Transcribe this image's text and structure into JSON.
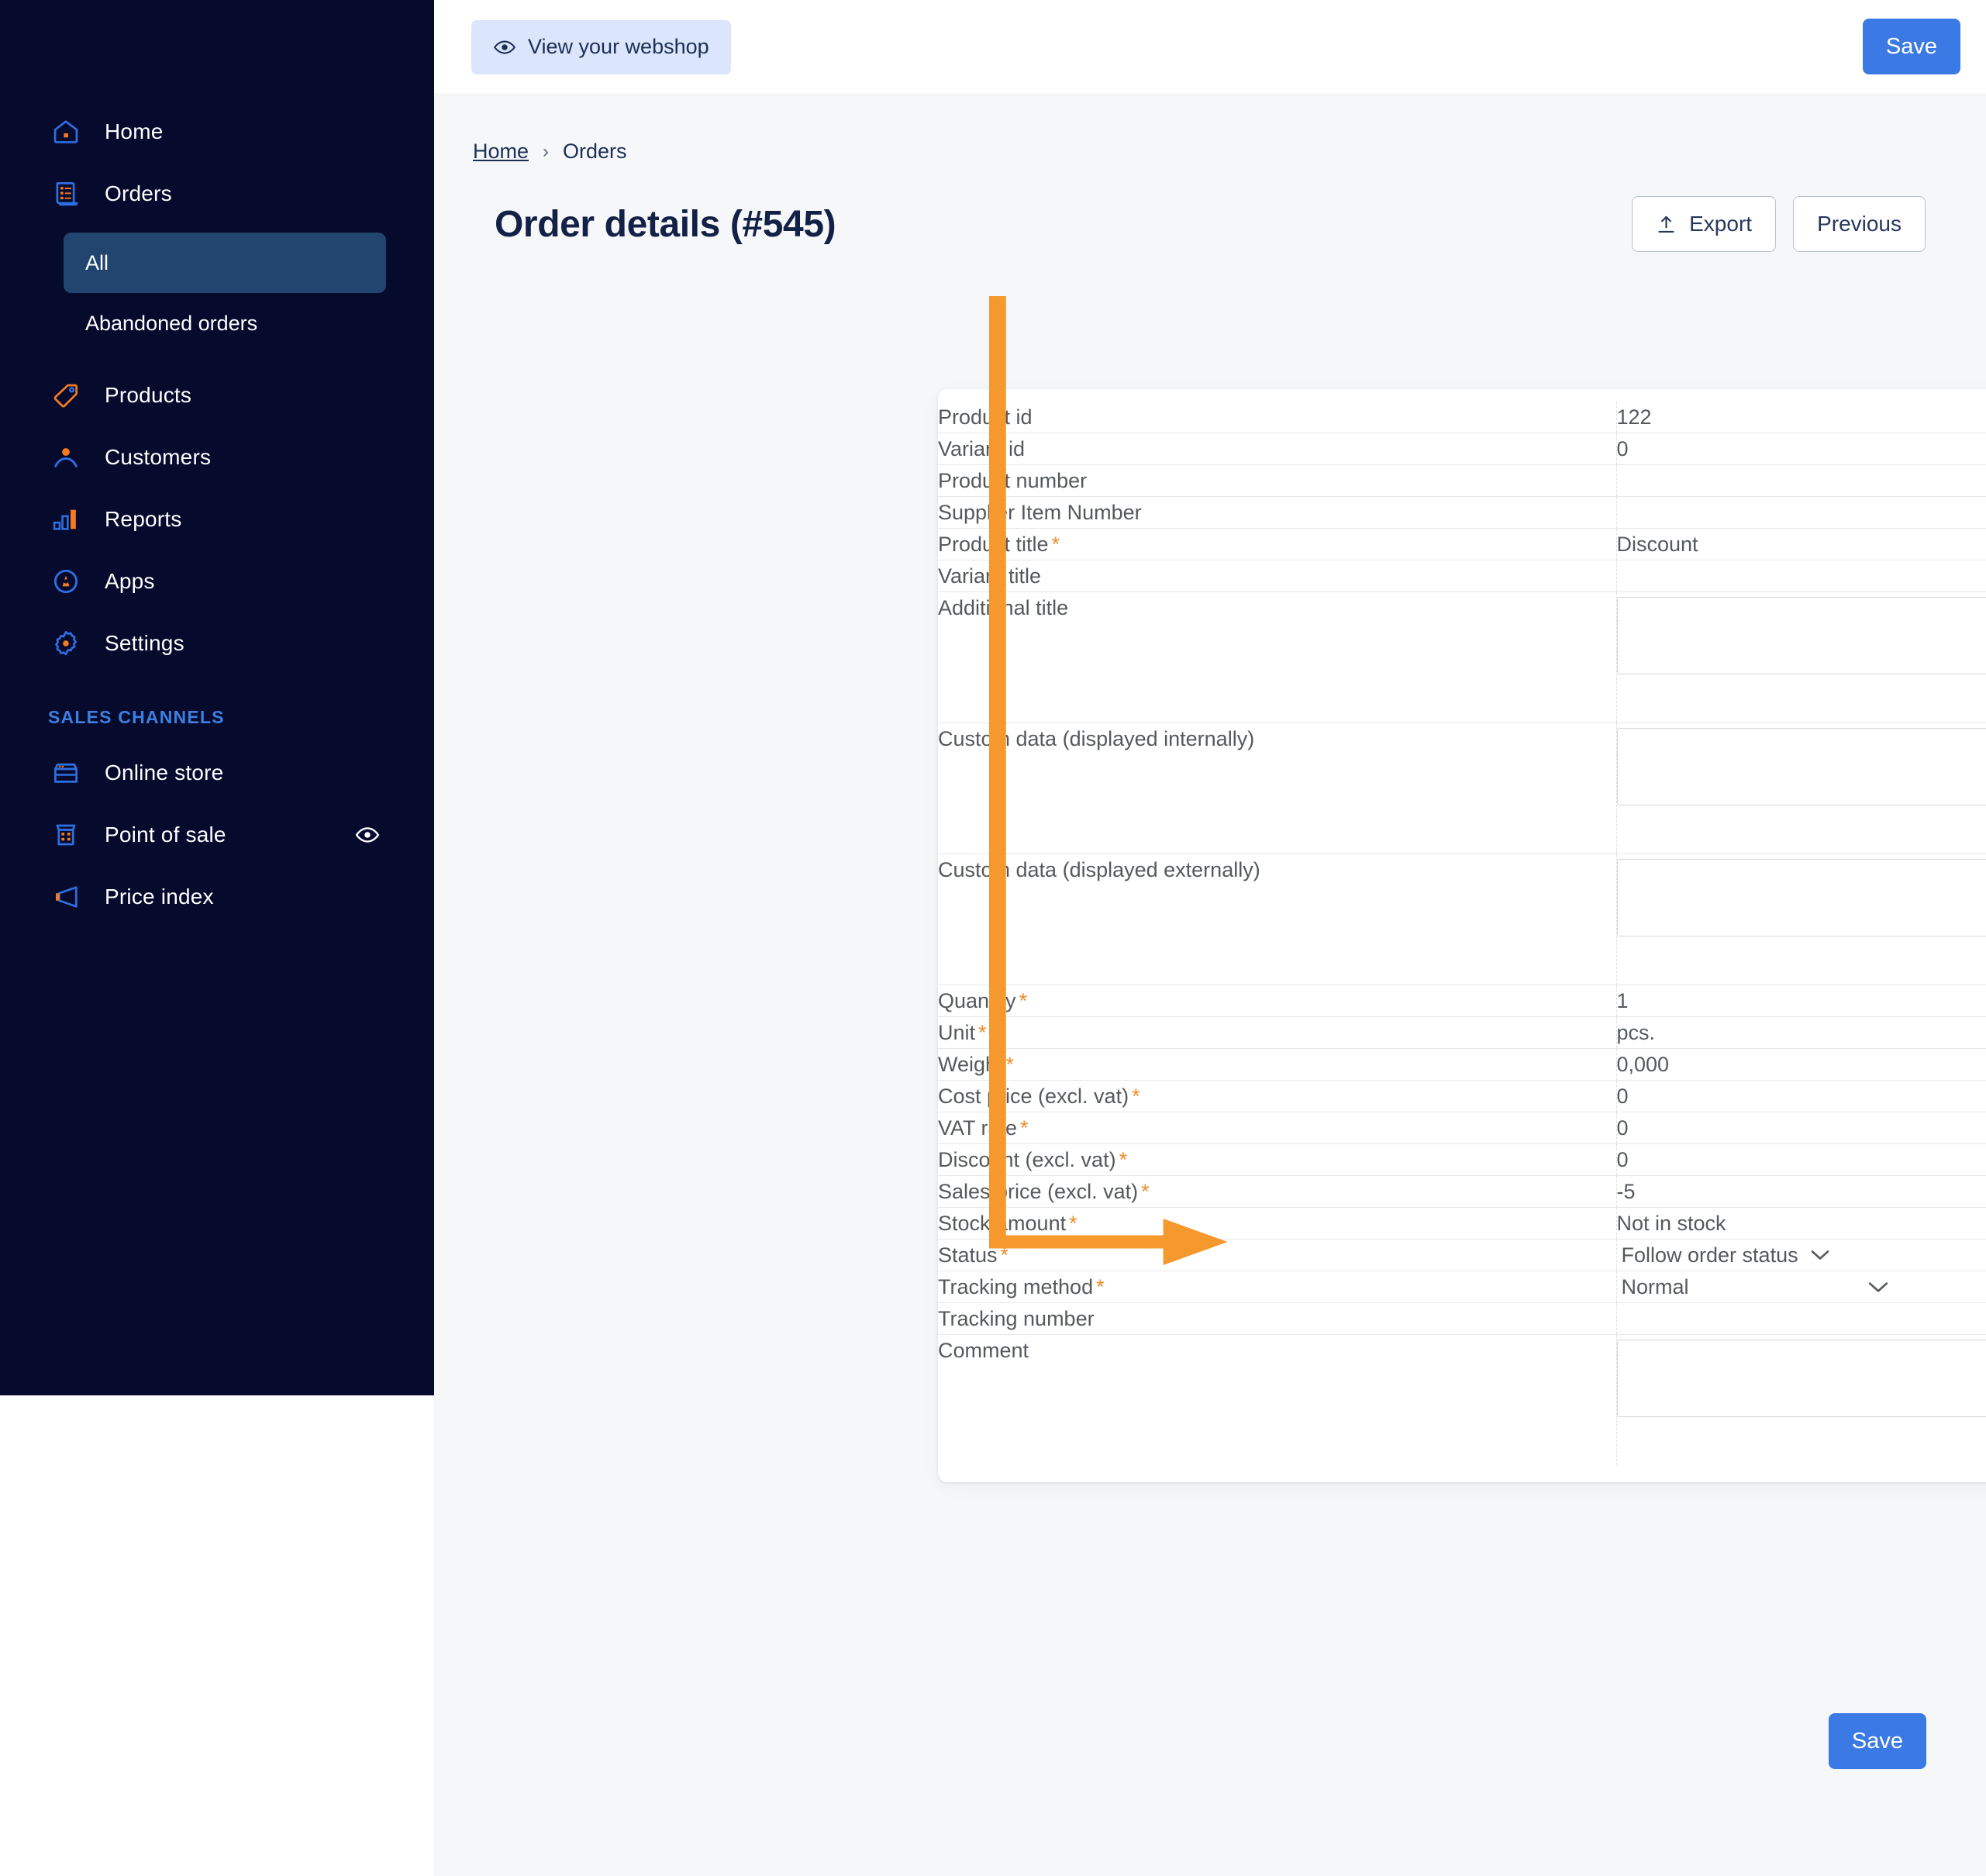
{
  "theme": {
    "sidebar_bg": "#060b2e",
    "sidebar_active_bg": "#21456f",
    "accent_blue": "#3b7ae4",
    "icon_blue": "#2f6fe0",
    "icon_orange": "#f47b20",
    "annotation_orange": "#f5992e",
    "required_orange": "#f08b2c",
    "page_bg": "#f6f7f9"
  },
  "sidebar": {
    "items": [
      {
        "label": "Home",
        "icon": "home-icon"
      },
      {
        "label": "Orders",
        "icon": "orders-icon"
      }
    ],
    "orders_sub": [
      {
        "label": "All",
        "active": true
      },
      {
        "label": "Abandoned orders",
        "active": false
      }
    ],
    "items2": [
      {
        "label": "Products",
        "icon": "tag-icon"
      },
      {
        "label": "Customers",
        "icon": "user-icon"
      },
      {
        "label": "Reports",
        "icon": "bar-chart-icon"
      },
      {
        "label": "Apps",
        "icon": "apps-icon"
      },
      {
        "label": "Settings",
        "icon": "gear-icon"
      }
    ],
    "group_title": "SALES CHANNELS",
    "channels": [
      {
        "label": "Online store",
        "icon": "store-icon",
        "trailing": null
      },
      {
        "label": "Point of sale",
        "icon": "pos-icon",
        "trailing": "eye-icon"
      },
      {
        "label": "Price index",
        "icon": "megaphone-icon",
        "trailing": null
      }
    ]
  },
  "topbar": {
    "view_webshop": "View your webshop",
    "save": "Save"
  },
  "breadcrumb": {
    "home": "Home",
    "separator": "›",
    "current": "Orders"
  },
  "header": {
    "title": "Order details (#545)",
    "export": "Export",
    "previous": "Previous"
  },
  "footer": {
    "save": "Save"
  },
  "table": {
    "rows": [
      {
        "label": "Product id",
        "required": false,
        "value": "122",
        "type": "text"
      },
      {
        "label": "Variant id",
        "required": false,
        "value": "0",
        "type": "text"
      },
      {
        "label": "Product number",
        "required": false,
        "value": "",
        "type": "text"
      },
      {
        "label": "Supplier Item Number",
        "required": false,
        "value": "",
        "type": "text"
      },
      {
        "label": "Product title",
        "required": true,
        "value": "Discount",
        "type": "text"
      },
      {
        "label": "Variant title",
        "required": false,
        "value": "",
        "type": "text"
      },
      {
        "label": "Additional title",
        "required": false,
        "value": "",
        "type": "textarea"
      },
      {
        "label": "Custom data (displayed internally)",
        "required": false,
        "value": "",
        "type": "textarea"
      },
      {
        "label": "Custom data (displayed externally)",
        "required": false,
        "value": "",
        "type": "textarea"
      },
      {
        "label": "Quantity",
        "required": true,
        "value": "1",
        "type": "text"
      },
      {
        "label": "Unit",
        "required": true,
        "value": "pcs.",
        "type": "text"
      },
      {
        "label": "Weight",
        "required": true,
        "value": "0,000",
        "type": "text"
      },
      {
        "label": "Cost price (excl. vat)",
        "required": true,
        "value": "0",
        "type": "text"
      },
      {
        "label": "VAT rate",
        "required": true,
        "value": "0",
        "type": "text"
      },
      {
        "label": "Discount (excl. vat)",
        "required": true,
        "value": "0",
        "type": "text"
      },
      {
        "label": "Sales price (excl. vat)",
        "required": true,
        "value": "-5",
        "type": "text"
      },
      {
        "label": "Stock amount",
        "required": true,
        "value": "Not in stock",
        "type": "text"
      },
      {
        "label": "Status",
        "required": true,
        "value": "Follow order status",
        "type": "select-inline"
      },
      {
        "label": "Tracking method",
        "required": true,
        "value": "Normal",
        "type": "select-wide"
      },
      {
        "label": "Tracking number",
        "required": false,
        "value": "",
        "type": "text"
      },
      {
        "label": "Comment",
        "required": false,
        "value": "",
        "type": "textarea"
      }
    ]
  },
  "annotation": {
    "color": "#f5992e",
    "description": "orange elbow arrow pointing from top of table down to the Sales price (excl. vat) value",
    "points": "vertical line x=1128 from y=382 to y=1602, then horizontal to x=1325 with arrowhead"
  }
}
